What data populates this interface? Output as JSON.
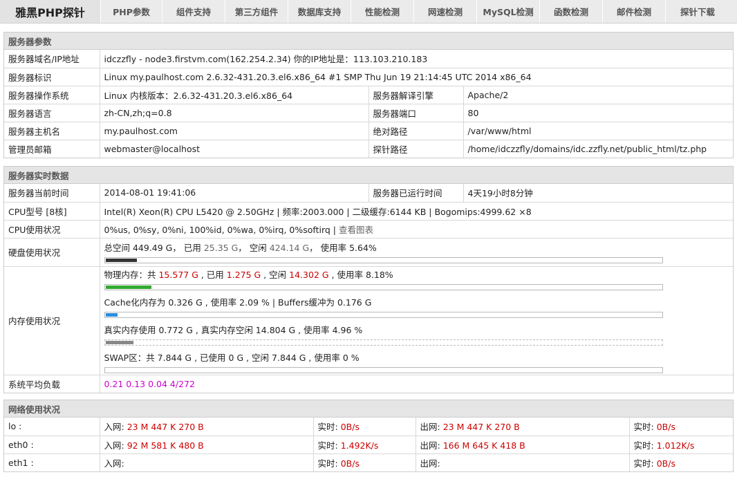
{
  "nav": {
    "brand": "雅黑PHP探针",
    "items": [
      "PHP参数",
      "组件支持",
      "第三方组件",
      "数据库支持",
      "性能检测",
      "网速检测",
      "MySQL检测",
      "函数检测",
      "邮件检测",
      "探针下载"
    ]
  },
  "server_params": {
    "title": "服务器参数",
    "domain_label": "服务器域名/IP地址",
    "domain_value": "idczzfly - node3.firstvm.com(162.254.2.34)  你的IP地址是：113.103.210.183",
    "ident_label": "服务器标识",
    "ident_value": "Linux my.paulhost.com 2.6.32-431.20.3.el6.x86_64 #1 SMP Thu Jun 19 21:14:45 UTC 2014 x86_64",
    "os_label": "服务器操作系统",
    "os_value": "Linux  内核版本：2.6.32-431.20.3.el6.x86_64",
    "engine_label": "服务器解译引擎",
    "engine_value": "Apache/2",
    "lang_label": "服务器语言",
    "lang_value": "zh-CN,zh;q=0.8",
    "port_label": "服务器端口",
    "port_value": "80",
    "host_label": "服务器主机名",
    "host_value": "my.paulhost.com",
    "abspath_label": "绝对路径",
    "abspath_value": "/var/www/html",
    "admin_label": "管理员邮箱",
    "admin_value": "webmaster@localhost",
    "probe_label": "探针路径",
    "probe_value": "/home/idczzfly/domains/idc.zzfly.net/public_html/tz.php"
  },
  "realtime": {
    "title": "服务器实时数据",
    "time_label": "服务器当前时间",
    "time_value": "2014-08-01 19:41:06",
    "uptime_label": "服务器已运行时间",
    "uptime_value": "4天19小时8分钟",
    "cpu_label": "CPU型号 [8核]",
    "cpu_value": "Intel(R) Xeon(R) CPU L5420 @ 2.50GHz | 频率:2003.000 | 二级缓存:6144 KB | Bogomips:4999.62 ×8",
    "cpuuse_label": "CPU使用状况",
    "cpuuse_value": "0%us, 0%sy, 0%ni, 100%id, 0%wa, 0%irq, 0%softirq | ",
    "cpuuse_link": "查看图表",
    "disk_label": "硬盘使用状况",
    "disk": {
      "p1": "总空间 449.49 G， 已用 ",
      "used": "25.35 G",
      "p2": "， 空闲 ",
      "free": "424.14 G",
      "p3": "， 使用率 5.64%",
      "percent": 5.64,
      "color": "#333333"
    },
    "mem_label": "内存使用状况",
    "mem_phys": {
      "p1": "物理内存：共 ",
      "total": "15.577 G",
      "p2": " , 已用 ",
      "used": "1.275 G",
      "p3": " , 空闲 ",
      "free": "14.302 G",
      "p4": " , 使用率 8.18%",
      "percent": 8.18,
      "color": "#33aa33"
    },
    "mem_cache": {
      "text": "Cache化内存为 0.326 G , 使用率 2.09 % | Buffers缓冲为 0.176 G",
      "percent": 2.09,
      "color": "#2a8ee0"
    },
    "mem_real": {
      "text": "真实内存使用 0.772 G , 真实内存空闲 14.804 G , 使用率 4.96 %",
      "percent": 4.96,
      "color": "#888888"
    },
    "mem_swap": {
      "text": "SWAP区：共 7.844 G , 已使用 0 G , 空闲 7.844 G , 使用率 0 %",
      "percent": 0,
      "color": "#888888"
    },
    "load_label": "系统平均负载",
    "load_value": "0.21 0.13 0.04 4/272"
  },
  "network": {
    "title": "网络使用状况",
    "in_label": "入网:",
    "out_label": "出网:",
    "rt_label": "实时:",
    "rows": [
      {
        "iface": "lo :",
        "in": "23 M 447 K 270 B",
        "in_rt": "0B/s",
        "out": "23 M 447 K 270 B",
        "out_rt": "0B/s"
      },
      {
        "iface": "eth0 :",
        "in": "92 M 581 K 480 B",
        "in_rt": "1.492K/s",
        "out": "166 M 645 K 418 B",
        "out_rt": "1.012K/s"
      },
      {
        "iface": "eth1 :",
        "in": "",
        "in_rt": "0B/s",
        "out": "",
        "out_rt": "0B/s"
      }
    ]
  }
}
